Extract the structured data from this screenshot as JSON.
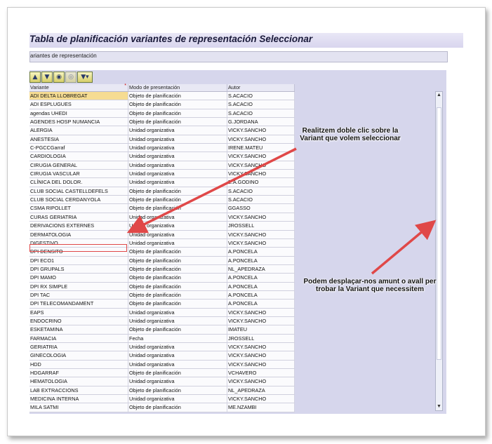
{
  "window": {
    "title": "Tabla de planificación variantes de representación Seleccionar"
  },
  "section": {
    "label": "ariantes de representación"
  },
  "toolbar": {
    "buttons": [
      {
        "icon": "sort-ascending-icon"
      },
      {
        "icon": "filter-icon"
      },
      {
        "icon": "find-icon"
      },
      {
        "icon": "find-next-icon"
      },
      {
        "icon": "filter-settings-icon"
      }
    ]
  },
  "table": {
    "columns": [
      "Variante",
      "Modo de presentación",
      "Autor"
    ],
    "rows": [
      [
        "ADI DELTA LLOBREGAT",
        "Objeto de planificación",
        "S.ACACIO"
      ],
      [
        "ADI ESPLUGUES",
        "Objeto de planificación",
        "S.ACACIO"
      ],
      [
        "agendas UHEDI",
        "Objeto de planificación",
        "S.ACACIO"
      ],
      [
        "AGENDES HOSP NUMANCIA",
        "Objeto de planificación",
        "G.JORDANA"
      ],
      [
        "ALERGIA",
        "Unidad organizativa",
        "VICKY.SANCHO"
      ],
      [
        "ANESTESIA",
        "Unidad organizativa",
        "VICKY.SANCHO"
      ],
      [
        "C-PGCCGarraf",
        "Unidad organizativa",
        "IRENE.MATEU"
      ],
      [
        "CARDIOLOGIA",
        "Unidad organizativa",
        "VICKY.SANCHO"
      ],
      [
        "CIRUGIA GENERAL",
        "Unidad organizativa",
        "VICKY.SANCHO"
      ],
      [
        "CIRUGIA VASCULAR",
        "Unidad organizativa",
        "VICKY.SANCHO"
      ],
      [
        "CLÍNICA DEL DOLOR.",
        "Unidad organizativa",
        "E.A.GODINO"
      ],
      [
        "CLUB SOCIAL CASTELLDEFELS",
        "Objeto de planificación",
        "S.ACACIO"
      ],
      [
        "CLUB SOCIAL CERDANYOLA",
        "Objeto de planificación",
        "S.ACACIO"
      ],
      [
        "CSMA RIPOLLET",
        "Objeto de planificación",
        "GGASSO"
      ],
      [
        "CURAS GERIATRIA",
        "Unidad organizativa",
        "VICKY.SANCHO"
      ],
      [
        "DERIVACIONS EXTERNES",
        "Unidad organizativa",
        "JROSSELL"
      ],
      [
        "DERMATOLOGIA",
        "Unidad organizativa",
        "VICKY.SANCHO"
      ],
      [
        "DIGESTIVO",
        "Unidad organizativa",
        "VICKY.SANCHO"
      ],
      [
        "DPI DENSITO",
        "Objeto de planificación",
        "A.PONCELA"
      ],
      [
        "DPI ECO1",
        "Objeto de planificación",
        "A.PONCELA"
      ],
      [
        "DPI GRUPALS",
        "Objeto de planificación",
        "NL_APEDRAZA"
      ],
      [
        "DPI MAMO",
        "Objeto de planificación",
        "A.PONCELA"
      ],
      [
        "DPI RX SIMPLE",
        "Objeto de planificación",
        "A.PONCELA"
      ],
      [
        "DPI TAC",
        "Objeto de planificación",
        "A.PONCELA"
      ],
      [
        "DPI TELECOMANDAMENT",
        "Objeto de planificación",
        "A.PONCELA"
      ],
      [
        "EAPS",
        "Unidad organizativa",
        "VICKY.SANCHO"
      ],
      [
        "ENDOCRINO",
        "Unidad organizativa",
        "VICKY.SANCHO"
      ],
      [
        "ESKETAMINA",
        "Objeto de planificación",
        "IMATEU"
      ],
      [
        "FARMACIA",
        "Fecha",
        "JROSSELL"
      ],
      [
        "GERIATRIA",
        "Unidad organizativa",
        "VICKY.SANCHO"
      ],
      [
        "GINECOLOGIA",
        "Unidad organizativa",
        "VICKY.SANCHO"
      ],
      [
        "HDD",
        "Unidad organizativa",
        "VICKY.SANCHO"
      ],
      [
        "HDGARRAF",
        "Objeto de planificación",
        "VCHAVERO"
      ],
      [
        "HEMATOLOGIA",
        "Unidad organizativa",
        "VICKY.SANCHO"
      ],
      [
        "LAB EXTRACCIONS",
        "Objeto de planificación",
        "NL_APEDRAZA"
      ],
      [
        "MEDICINA INTERNA",
        "Unidad organizativa",
        "VICKY.SANCHO"
      ],
      [
        "MILA SATMI",
        "Objeto de planificación",
        "ME.NZAMBI"
      ]
    ]
  },
  "annotations": {
    "double_click": "Realitzem doble clic sobre la Variant que volem seleccionar",
    "scroll": "Podem desplaçar-nos amunt o avall per trobar la Variant que necessitem"
  },
  "scrollbar": {
    "up_icon": "scroll-up-icon",
    "down_icon": "scroll-down-icon"
  },
  "colors": {
    "selected_cell": "#f6dc92",
    "annotation_arrow": "#e04848",
    "panel": "#d6d6ec"
  }
}
